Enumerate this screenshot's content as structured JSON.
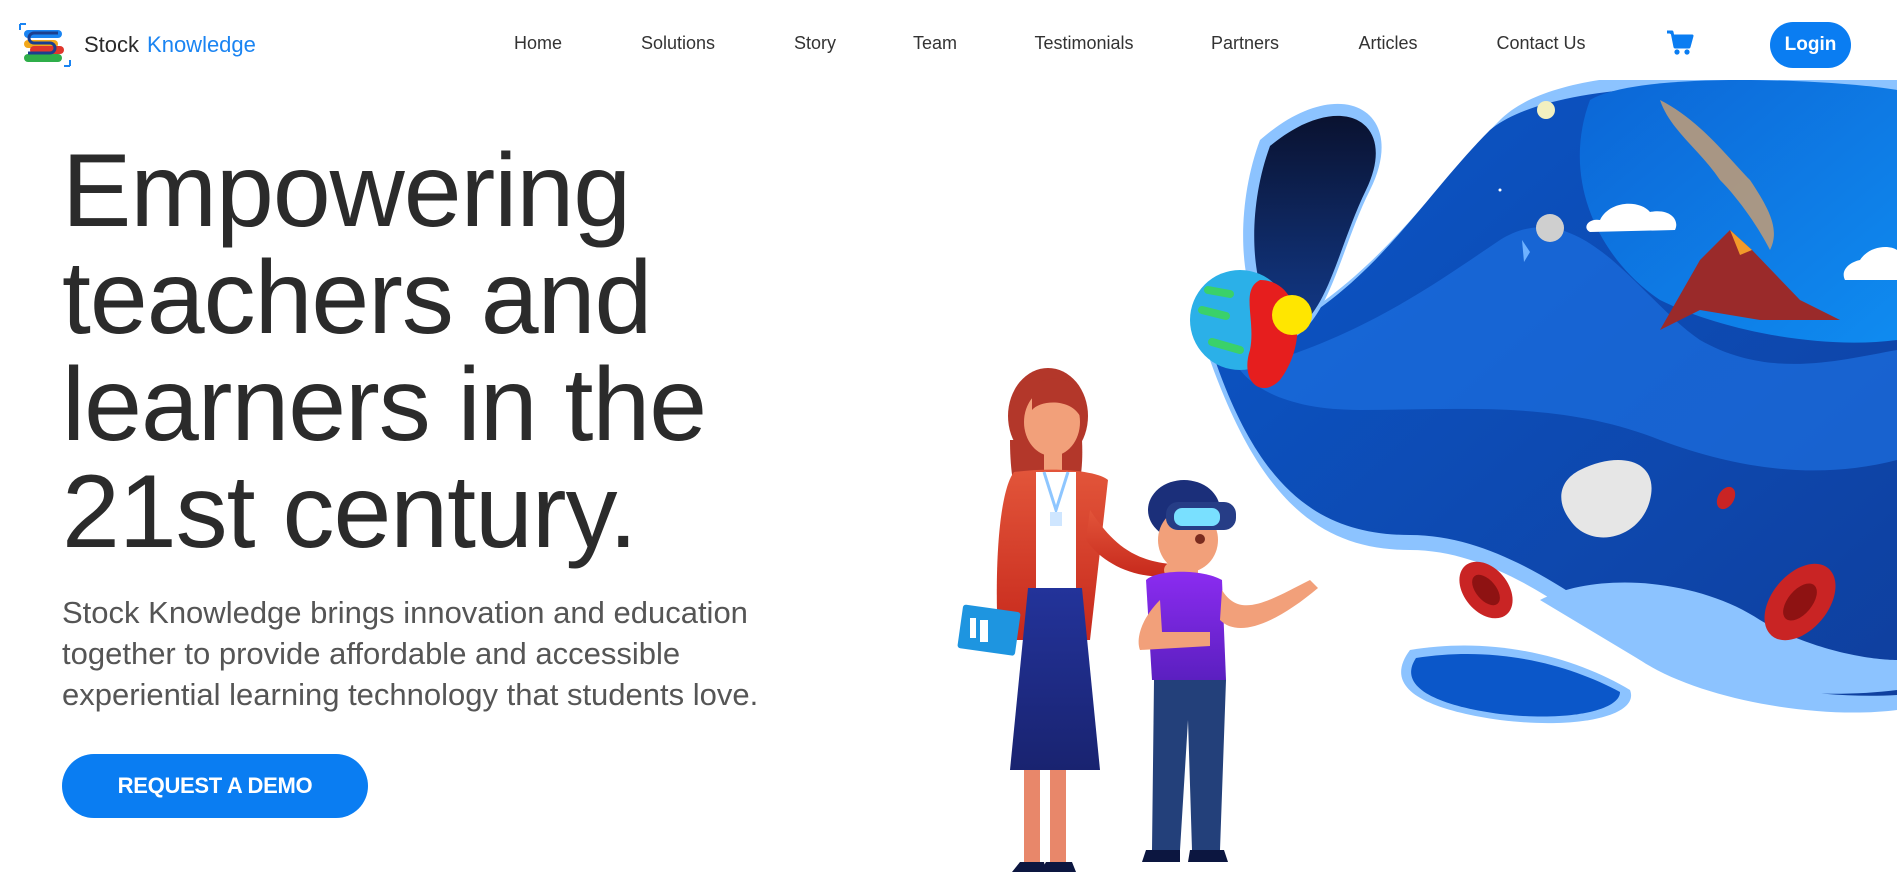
{
  "brand": {
    "name_part1": "Stock",
    "name_part2": "Knowledge"
  },
  "nav": {
    "items": [
      {
        "label": "Home"
      },
      {
        "label": "Solutions"
      },
      {
        "label": "Story"
      },
      {
        "label": "Team"
      },
      {
        "label": "Testimonials"
      },
      {
        "label": "Partners"
      },
      {
        "label": "Articles"
      },
      {
        "label": "Contact Us"
      }
    ],
    "cart_icon": "shopping-cart-icon",
    "login_label": "Login"
  },
  "hero": {
    "title_lines": [
      "Empowering",
      "teachers and",
      "learners in the",
      "21st century."
    ],
    "subtitle_lines": [
      "Stock Knowledge brings innovation and education",
      "together to provide affordable and accessible",
      "experiential learning technology that students love."
    ],
    "cta_label": "REQUEST A DEMO"
  },
  "colors": {
    "accent": "#0a7df2",
    "text": "#2b2b2b",
    "subtext": "#555555"
  }
}
